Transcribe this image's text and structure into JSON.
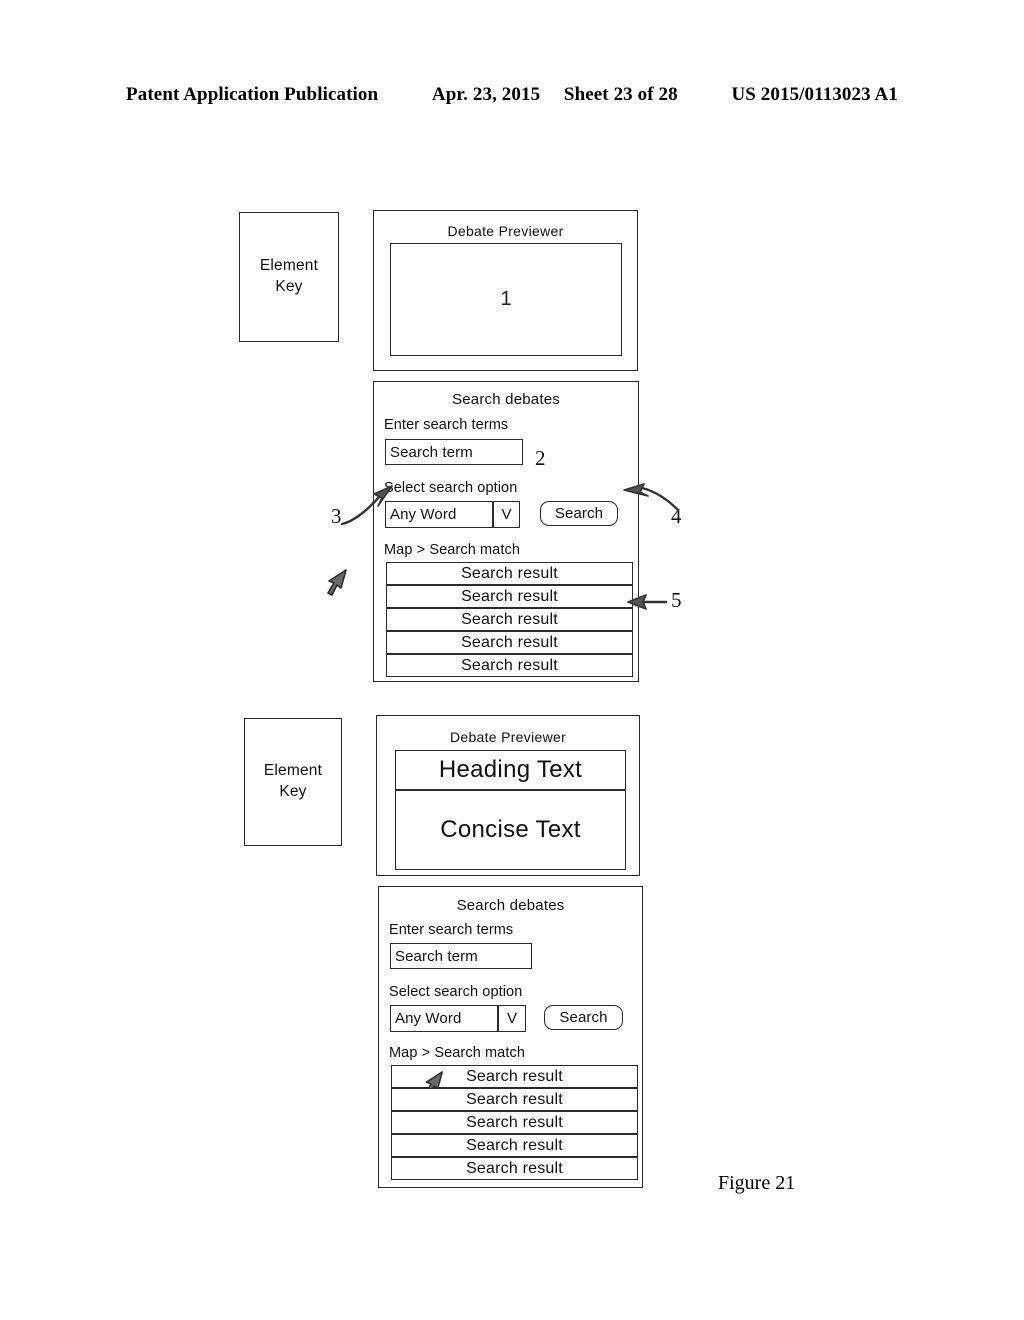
{
  "header": {
    "publication": "Patent Application Publication",
    "date": "Apr. 23, 2015",
    "sheet": "Sheet 23 of 28",
    "docnum": "US 2015/0113023 A1"
  },
  "figure": {
    "caption": "Figure 21"
  },
  "colors": {
    "ink": "#1a1a1a",
    "paper": "#ffffff",
    "line": "#2b2b2b"
  },
  "top_diagram": {
    "element_key": {
      "line1": "Element",
      "line2": "Key"
    },
    "previewer": {
      "title": "Debate Previewer",
      "content": "1"
    },
    "search_panel": {
      "title": "Search debates",
      "enter_terms_label": "Enter search terms",
      "search_term_value": "Search term",
      "search_term_placeholder": "Search term",
      "select_option_label": "Select search option",
      "selected_option": "Any Word",
      "caret_glyph": "V",
      "search_button": "Search",
      "results_label": "Map > Search match",
      "results": [
        "Search result",
        "Search result",
        "Search result",
        "Search result",
        "Search result"
      ]
    },
    "callouts": [
      {
        "id": "2",
        "label": "2"
      },
      {
        "id": "3",
        "label": "3"
      },
      {
        "id": "4",
        "label": "4"
      },
      {
        "id": "5",
        "label": "5"
      }
    ]
  },
  "bottom_diagram": {
    "element_key": {
      "line1": "Element",
      "line2": "Key"
    },
    "previewer": {
      "title": "Debate Previewer",
      "heading_text": "Heading Text",
      "concise_text": "Concise Text"
    },
    "search_panel": {
      "title": "Search debates",
      "enter_terms_label": "Enter search terms",
      "search_term_value": "Search term",
      "search_term_placeholder": "Search term",
      "select_option_label": "Select search option",
      "selected_option": "Any Word",
      "caret_glyph": "V",
      "search_button": "Search",
      "results_label": "Map > Search match",
      "results": [
        "Search result",
        "Search result",
        "Search result",
        "Search result",
        "Search result"
      ]
    }
  }
}
